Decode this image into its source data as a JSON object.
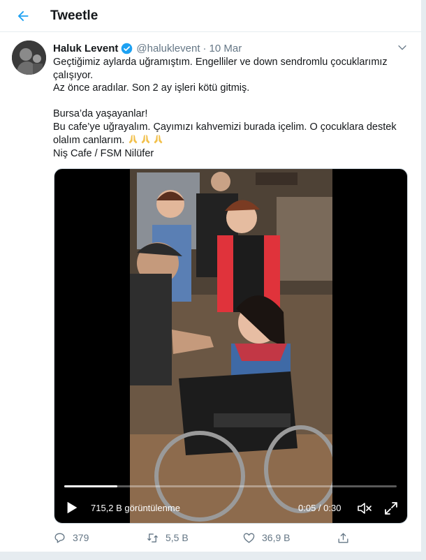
{
  "header": {
    "title": "Tweetle",
    "back_icon": "arrow-left-icon"
  },
  "tweet": {
    "author": {
      "display_name": "Haluk Levent",
      "handle": "@haluklevent",
      "verified": true
    },
    "separator": "·",
    "date": "10 Mar",
    "text_lines": [
      "Geçtiğimiz aylarda uğramıştım. Engelliler ve down sendromlu çocuklarımız",
      "çalışıyor.",
      "Az önce aradılar. Son 2 ay işleri kötü gitmiş.",
      "",
      "Bursa’da yaşayanlar!",
      "Bu cafe’ye uğrayalım. Çayımızı kahvemizi burada içelim. O çocuklara destek",
      "olalım canlarım.",
      "Niş Cafe / FSM Nilüfer"
    ],
    "emoji": [
      "🙏",
      "🙏",
      "🙏"
    ],
    "video": {
      "views": "715,2 B görüntülenme",
      "duration": "0:05 / 0:30",
      "progress": 0.16
    },
    "actions": {
      "reply_count": "379",
      "retweet_count": "5,5 B",
      "like_count": "36,9 B"
    }
  },
  "colors": {
    "accent": "#1da1f2",
    "text": "#14171a",
    "muted": "#657786",
    "border": "#e6ecf0"
  }
}
